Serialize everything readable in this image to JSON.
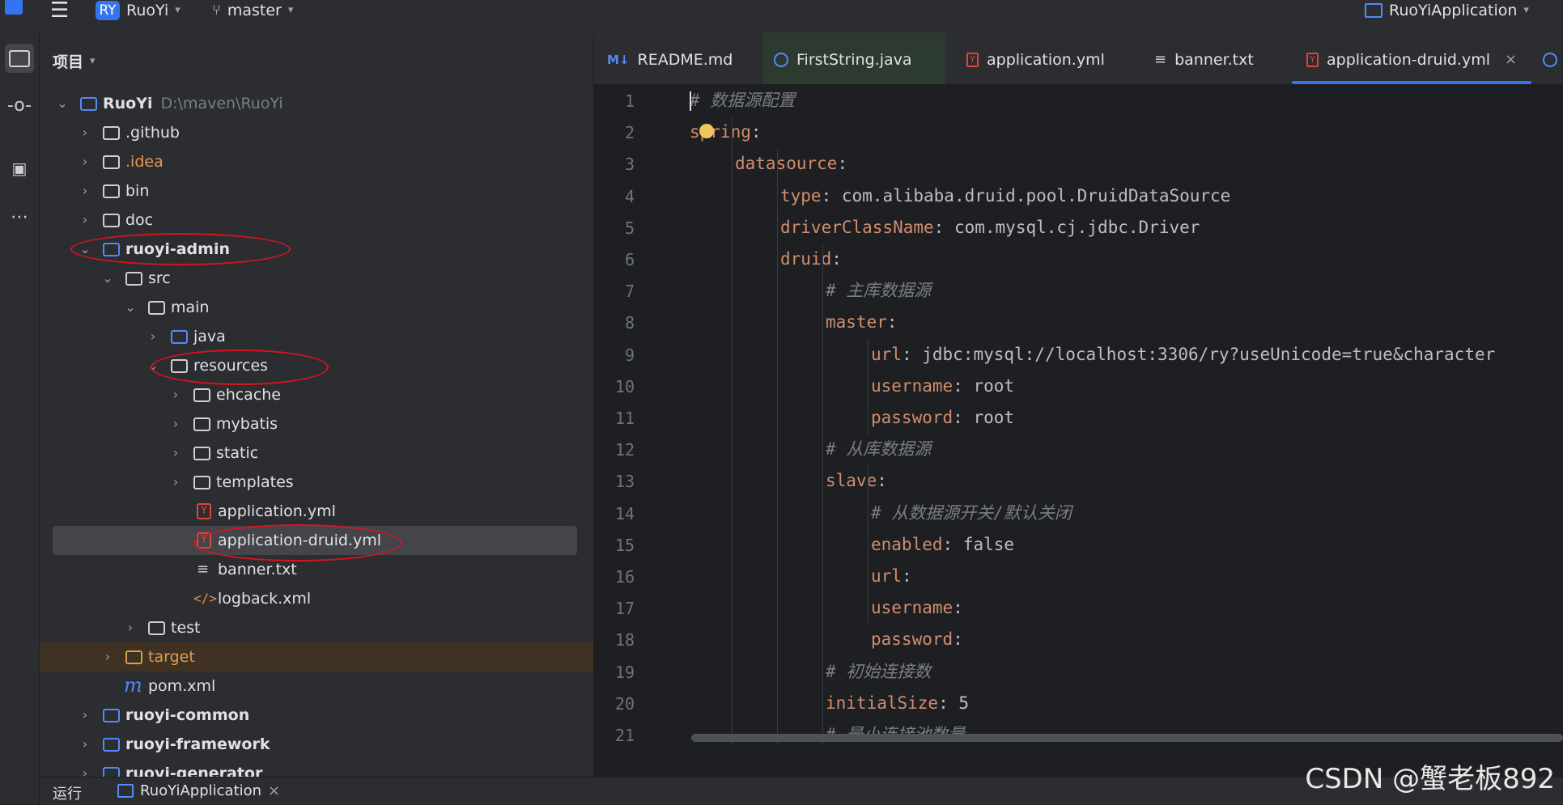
{
  "toolbar": {
    "project_badge": "RY",
    "project_name": "RuoYi",
    "branch": "master",
    "run_config": "RuoYiApplication"
  },
  "project_panel": {
    "title": "项目",
    "tree": [
      {
        "label": "RuoYi",
        "path": "D:\\maven\\RuoYi"
      },
      {
        "label": ".github"
      },
      {
        "label": ".idea"
      },
      {
        "label": "bin"
      },
      {
        "label": "doc"
      },
      {
        "label": "ruoyi-admin"
      },
      {
        "label": "src"
      },
      {
        "label": "main"
      },
      {
        "label": "java"
      },
      {
        "label": "resources"
      },
      {
        "label": "ehcache"
      },
      {
        "label": "mybatis"
      },
      {
        "label": "static"
      },
      {
        "label": "templates"
      },
      {
        "label": "application.yml"
      },
      {
        "label": "application-druid.yml"
      },
      {
        "label": "banner.txt"
      },
      {
        "label": "logback.xml"
      },
      {
        "label": "test"
      },
      {
        "label": "target"
      },
      {
        "label": "pom.xml"
      },
      {
        "label": "ruoyi-common"
      },
      {
        "label": "ruoyi-framework"
      },
      {
        "label": "ruoyi-generator"
      }
    ]
  },
  "tabs": [
    {
      "label": "README.md",
      "icon": "markdown-icon"
    },
    {
      "label": "FirstString.java",
      "icon": "java-class-icon"
    },
    {
      "label": "application.yml",
      "icon": "yaml-icon"
    },
    {
      "label": "banner.txt",
      "icon": "text-file-icon"
    },
    {
      "label": "application-druid.yml",
      "icon": "yaml-icon",
      "active": true
    }
  ],
  "editor": {
    "lines": [
      {
        "n": "1",
        "key": "",
        "val": "",
        "comment": "# 数据源配置"
      },
      {
        "n": "2",
        "key": "spring",
        "val": "",
        "comment": ""
      },
      {
        "n": "3",
        "key": "datasource",
        "val": "",
        "comment": ""
      },
      {
        "n": "4",
        "key": "type",
        "val": " com.alibaba.druid.pool.DruidDataSource",
        "comment": ""
      },
      {
        "n": "5",
        "key": "driverClassName",
        "val": " com.mysql.cj.jdbc.Driver",
        "comment": ""
      },
      {
        "n": "6",
        "key": "druid",
        "val": "",
        "comment": ""
      },
      {
        "n": "7",
        "key": "",
        "val": "",
        "comment": "# 主库数据源"
      },
      {
        "n": "8",
        "key": "master",
        "val": "",
        "comment": ""
      },
      {
        "n": "9",
        "key": "url",
        "val": " jdbc:mysql://localhost:3306/ry?useUnicode=true&character",
        "comment": ""
      },
      {
        "n": "10",
        "key": "username",
        "val": " root",
        "comment": ""
      },
      {
        "n": "11",
        "key": "password",
        "val": " root",
        "comment": ""
      },
      {
        "n": "12",
        "key": "",
        "val": "",
        "comment": "# 从库数据源"
      },
      {
        "n": "13",
        "key": "slave",
        "val": "",
        "comment": ""
      },
      {
        "n": "14",
        "key": "",
        "val": "",
        "comment": "# 从数据源开关/默认关闭"
      },
      {
        "n": "15",
        "key": "enabled",
        "val": " false",
        "comment": ""
      },
      {
        "n": "16",
        "key": "url",
        "val": "",
        "comment": ""
      },
      {
        "n": "17",
        "key": "username",
        "val": "",
        "comment": ""
      },
      {
        "n": "18",
        "key": "password",
        "val": "",
        "comment": ""
      },
      {
        "n": "19",
        "key": "",
        "val": "",
        "comment": "# 初始连接数"
      },
      {
        "n": "20",
        "key": "initialSize",
        "val": " 5",
        "comment": ""
      },
      {
        "n": "21",
        "key": "",
        "val": "",
        "comment": "# 最小连接池数量"
      }
    ]
  },
  "bottom_panel": {
    "run_label": "运行",
    "run_tab": "RuoYiApplication"
  },
  "watermark": "CSDN @蟹老板892"
}
